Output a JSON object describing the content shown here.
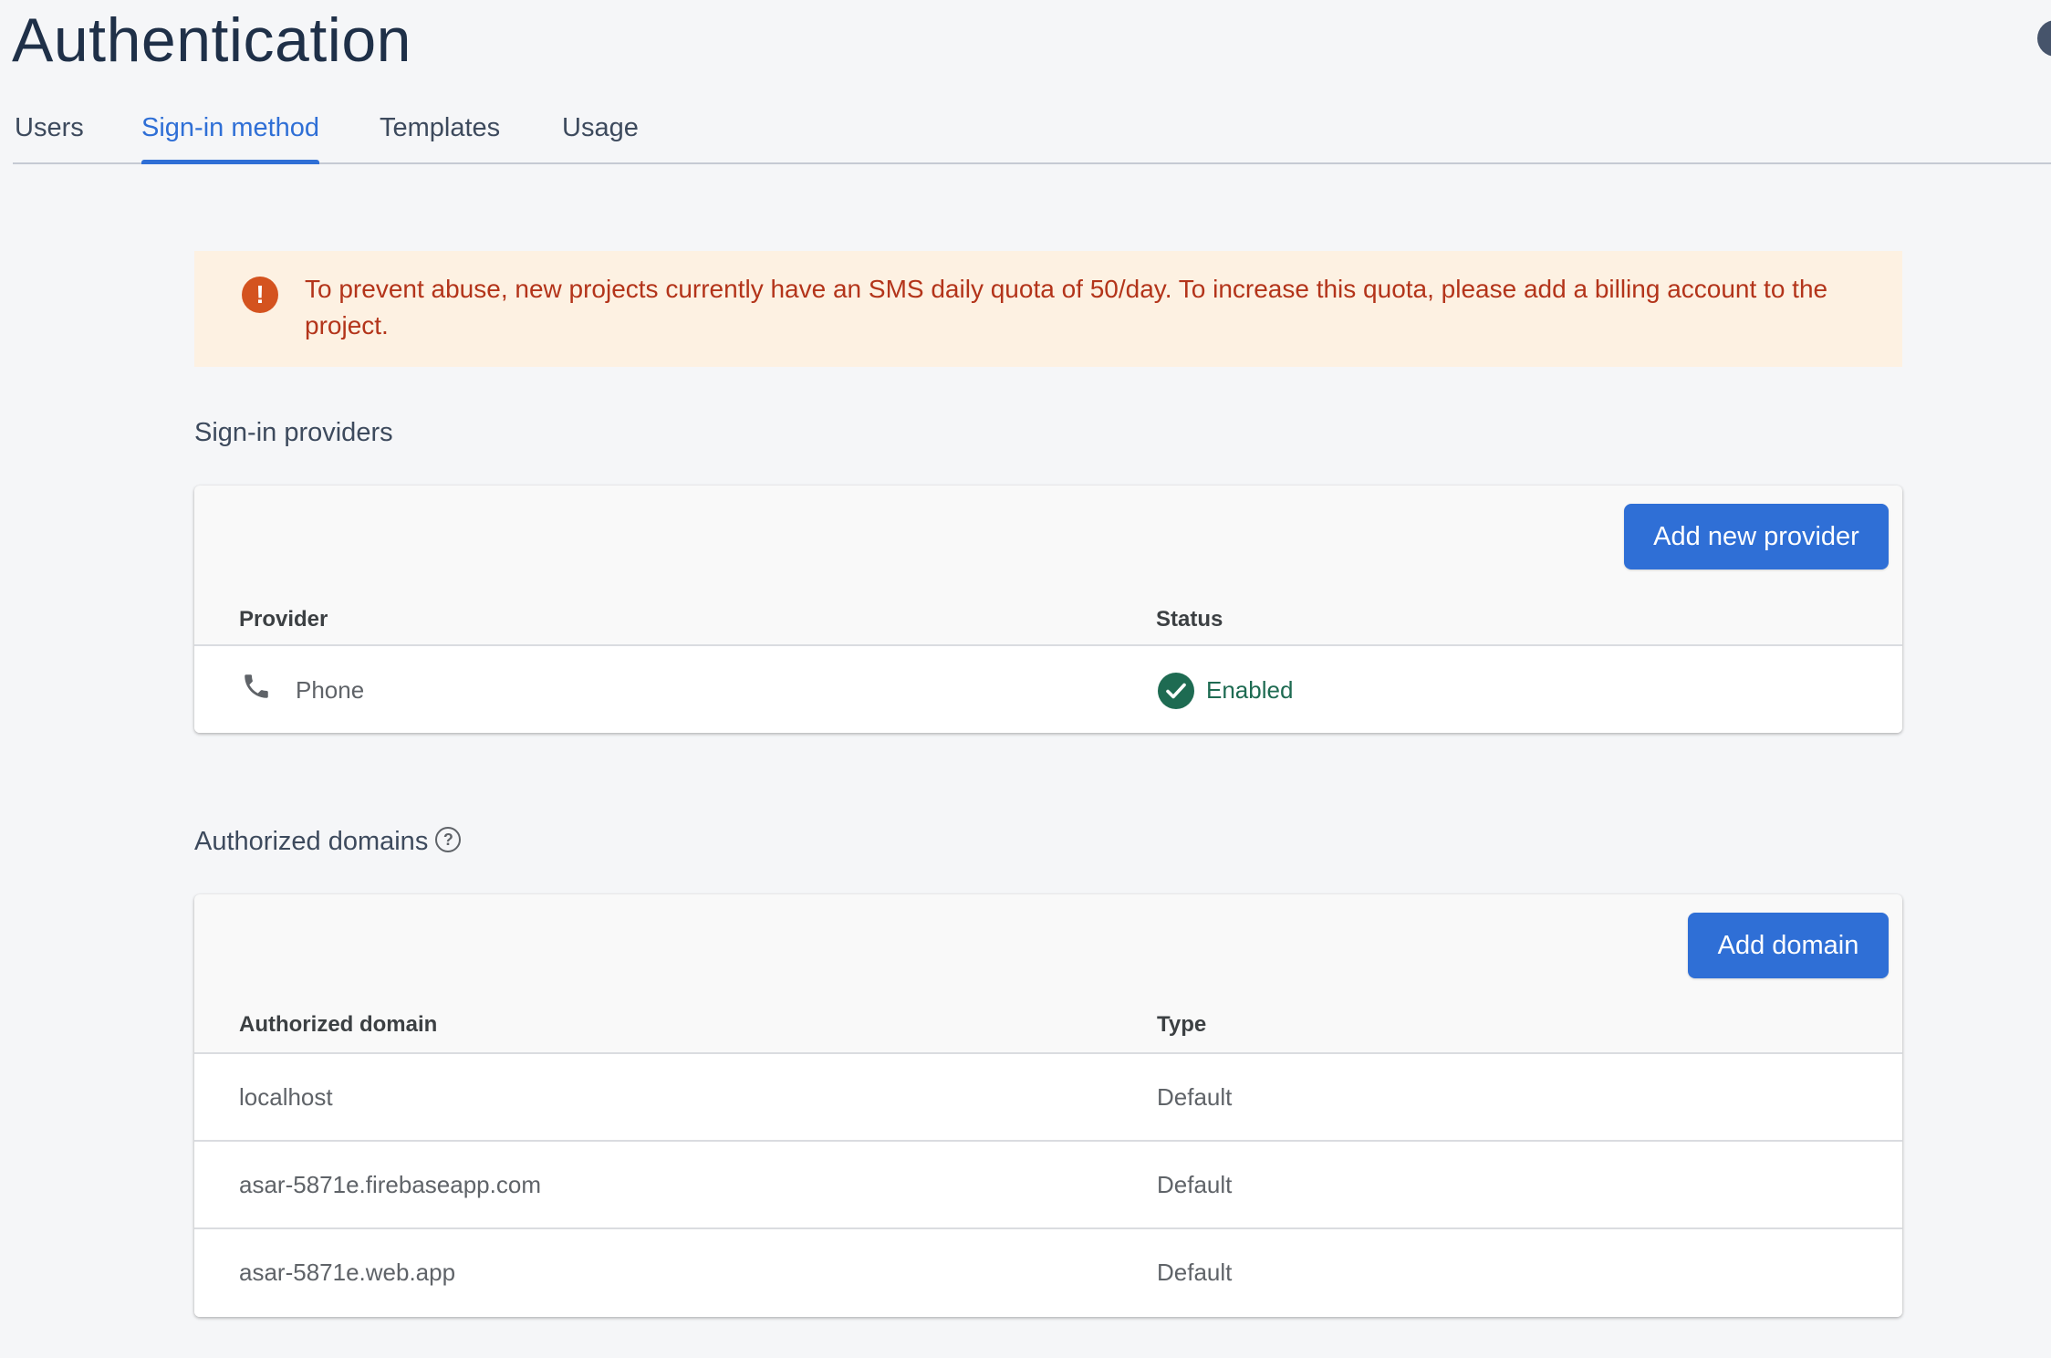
{
  "page": {
    "title": "Authentication"
  },
  "tabs": [
    {
      "label": "Users",
      "active": false
    },
    {
      "label": "Sign-in method",
      "active": true
    },
    {
      "label": "Templates",
      "active": false
    },
    {
      "label": "Usage",
      "active": false
    }
  ],
  "alert": {
    "icon": "error-icon",
    "text": "To prevent abuse, new projects currently have an SMS daily quota of 50/day. To increase this quota, please add a billing account to the project."
  },
  "providers": {
    "heading": "Sign-in providers",
    "add_button": "Add new provider",
    "columns": [
      "Provider",
      "Status"
    ],
    "rows": [
      {
        "icon": "phone-icon",
        "name": "Phone",
        "status": "Enabled",
        "status_icon": "check-circle-icon"
      }
    ]
  },
  "domains": {
    "heading": "Authorized domains",
    "help_icon": "help-icon",
    "add_button": "Add domain",
    "columns": [
      "Authorized domain",
      "Type"
    ],
    "rows": [
      {
        "domain": "localhost",
        "type": "Default"
      },
      {
        "domain": "asar-5871e.firebaseapp.com",
        "type": "Default"
      },
      {
        "domain": "asar-5871e.web.app",
        "type": "Default"
      }
    ]
  },
  "colors": {
    "accent": "#2f6fd6",
    "alert_bg": "#fdf1e2",
    "alert_text": "#b3341a",
    "enabled": "#1e6b52"
  }
}
